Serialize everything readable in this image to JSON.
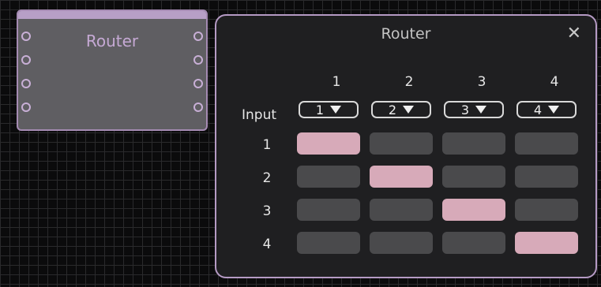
{
  "node": {
    "title": "Router",
    "left_ports": 4,
    "right_ports": 4
  },
  "panel": {
    "title": "Router",
    "close": "✕",
    "input_label": "Input",
    "columns": [
      "1",
      "2",
      "3",
      "4"
    ],
    "input_selects": [
      "1",
      "2",
      "3",
      "4"
    ],
    "rows": [
      "1",
      "2",
      "3",
      "4"
    ],
    "active_routes": [
      [
        1,
        0,
        0,
        0
      ],
      [
        0,
        1,
        0,
        0
      ],
      [
        0,
        0,
        1,
        0
      ],
      [
        0,
        0,
        0,
        1
      ]
    ]
  },
  "colors": {
    "active_cell": "#d7aab9",
    "inactive_cell": "#4a4a4c",
    "accent": "#b59ac4"
  }
}
